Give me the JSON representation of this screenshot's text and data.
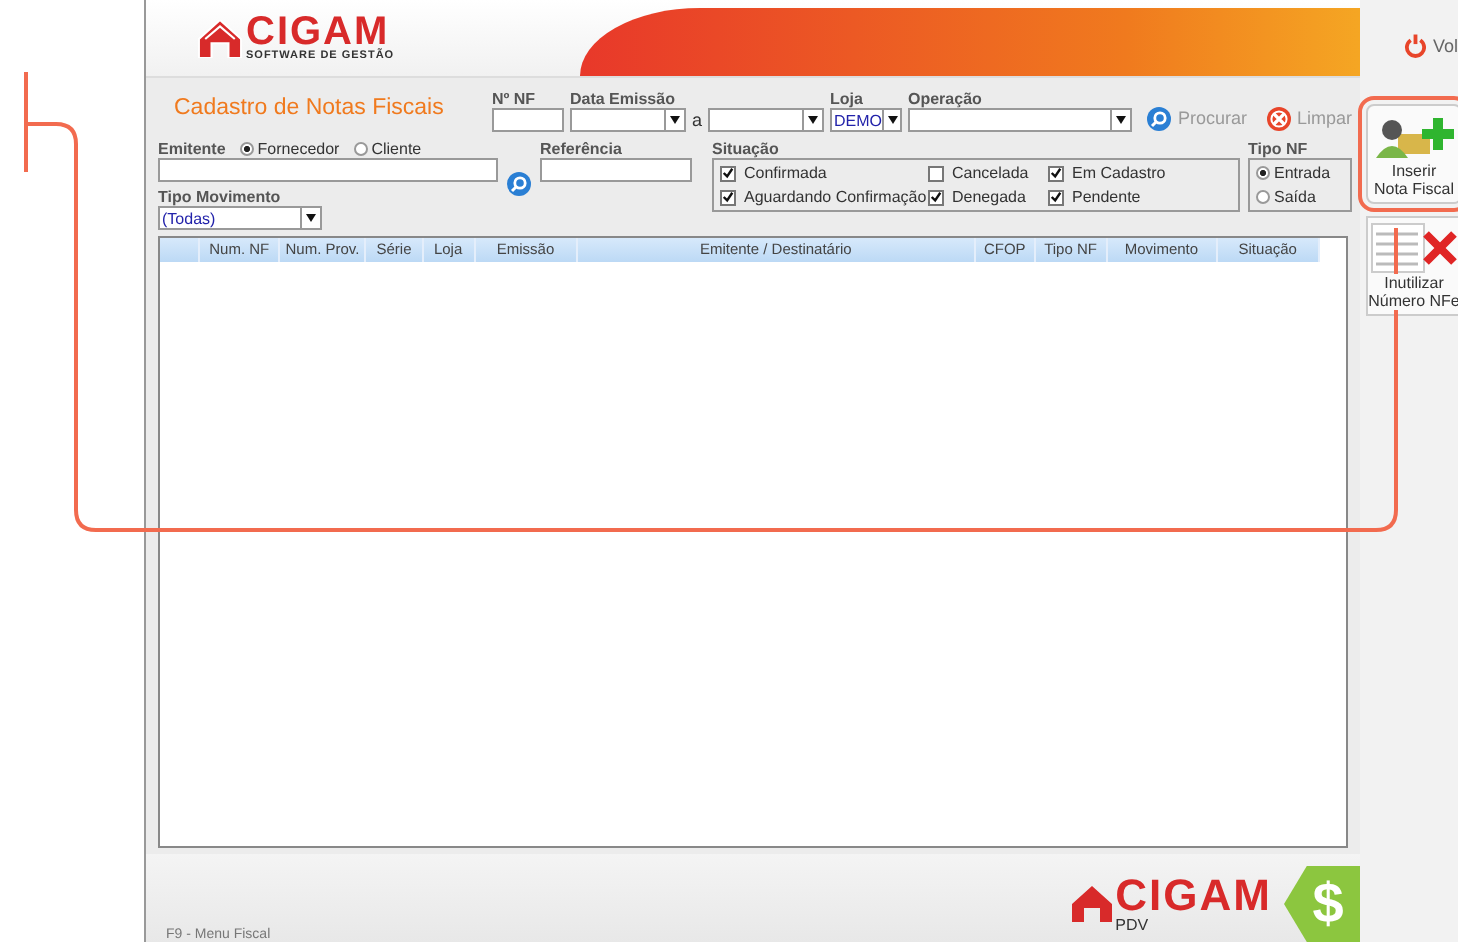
{
  "header": {
    "logo_text": "CIGAM",
    "logo_subtitle": "SOFTWARE DE GESTÃO"
  },
  "form": {
    "title": "Cadastro de Notas Fiscais",
    "nf_number": {
      "label": "Nº NF"
    },
    "issue_date": {
      "label": "Data Emissão",
      "separator": "a"
    },
    "store": {
      "label": "Loja",
      "value": "DEMO"
    },
    "operation": {
      "label": "Operação"
    },
    "search_button": "Procurar",
    "clear_button": "Limpar",
    "issuer": {
      "label": "Emitente",
      "options": [
        {
          "label": "Fornecedor",
          "selected": true
        },
        {
          "label": "Cliente",
          "selected": false
        }
      ]
    },
    "reference": {
      "label": "Referência"
    },
    "movement_type": {
      "label": "Tipo Movimento",
      "value": "(Todas)"
    },
    "status": {
      "label": "Situação",
      "options": [
        {
          "label": "Confirmada",
          "checked": true
        },
        {
          "label": "Cancelada",
          "checked": false
        },
        {
          "label": "Em Cadastro",
          "checked": true
        },
        {
          "label": "Aguardando Confirmação",
          "checked": true
        },
        {
          "label": "Denegada",
          "checked": true
        },
        {
          "label": "Pendente",
          "checked": true
        }
      ]
    },
    "nf_type": {
      "label": "Tipo NF",
      "options": [
        {
          "label": "Entrada",
          "selected": true
        },
        {
          "label": "Saída",
          "selected": false
        }
      ]
    }
  },
  "table": {
    "columns": [
      "Num. NF",
      "Num. Prov.",
      "Série",
      "Loja",
      "Emissão",
      "Emitente / Destinatário",
      "CFOP",
      "Tipo NF",
      "Movimento",
      "Situação"
    ]
  },
  "footer": {
    "hint": "F9 - Menu Fiscal",
    "logo_text": "CIGAM",
    "logo_subtitle": "PDV",
    "badge_symbol": "$"
  },
  "sidebar": {
    "back_button": "Vol",
    "actions": [
      {
        "kind": "insert",
        "lines": [
          "Inserir",
          "Nota Fiscal"
        ],
        "highlighted": true
      },
      {
        "kind": "void",
        "lines": [
          "Inutilizar",
          "Número NFe"
        ],
        "highlighted": false
      }
    ]
  }
}
